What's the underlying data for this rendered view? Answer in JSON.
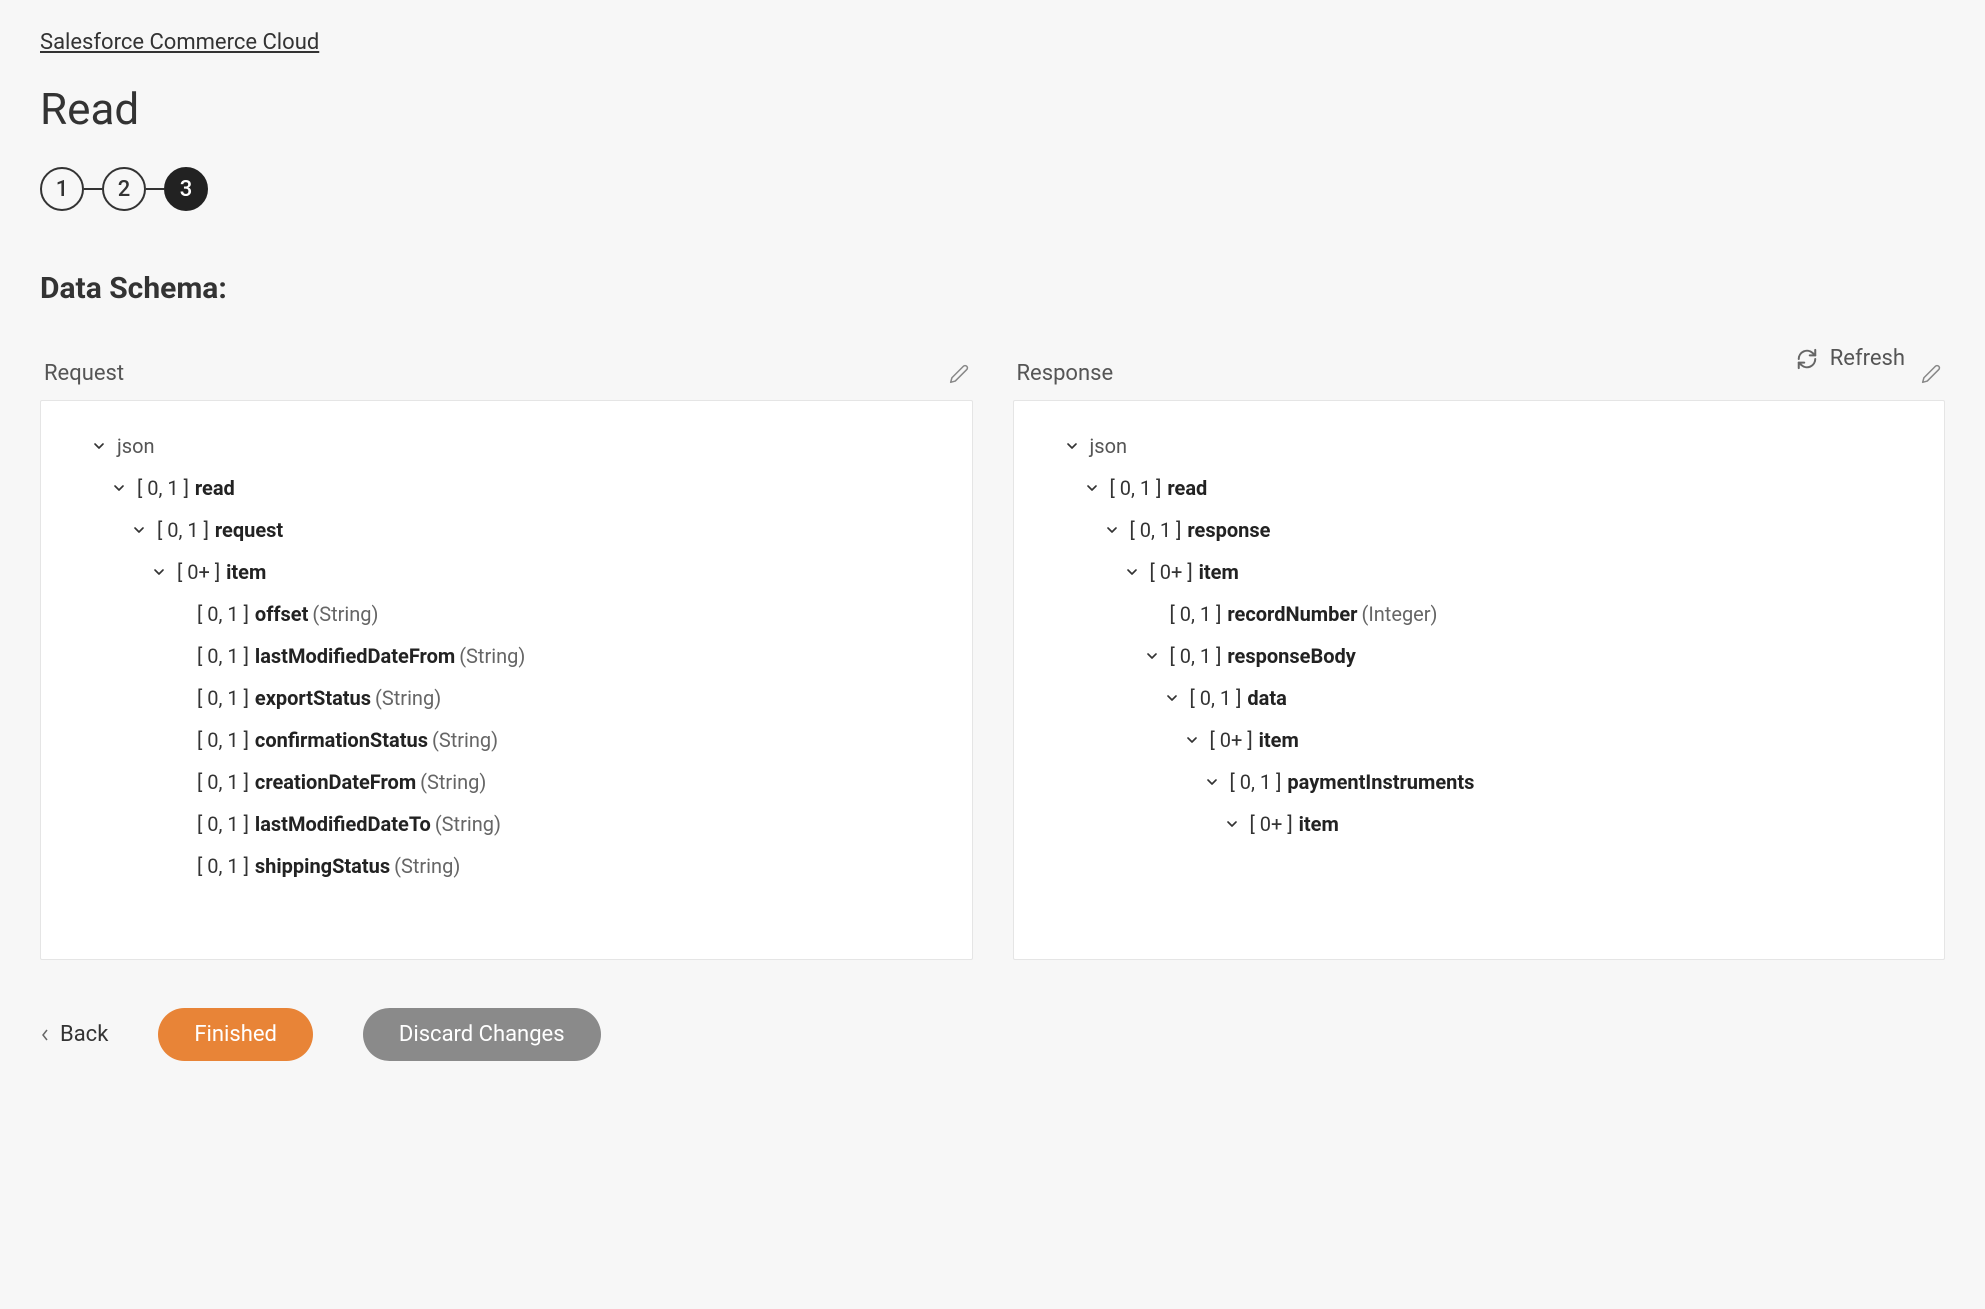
{
  "breadcrumb": {
    "link_label": "Salesforce Commerce Cloud"
  },
  "page": {
    "title": "Read"
  },
  "stepper": {
    "steps": [
      "1",
      "2",
      "3"
    ],
    "active_index": 2
  },
  "section": {
    "heading": "Data Schema:"
  },
  "actions": {
    "refresh_label": "Refresh",
    "back_label": "Back",
    "finished_label": "Finished",
    "discard_label": "Discard Changes"
  },
  "panels": {
    "request": {
      "label": "Request",
      "tree": [
        {
          "indent": 0,
          "expandable": true,
          "cardinality": "",
          "name": "json",
          "bold": false,
          "type": ""
        },
        {
          "indent": 1,
          "expandable": true,
          "cardinality": "[ 0, 1 ]",
          "name": "read",
          "bold": true,
          "type": ""
        },
        {
          "indent": 2,
          "expandable": true,
          "cardinality": "[ 0, 1 ]",
          "name": "request",
          "bold": true,
          "type": ""
        },
        {
          "indent": 3,
          "expandable": true,
          "cardinality": "[ 0+ ]",
          "name": "item",
          "bold": true,
          "type": ""
        },
        {
          "indent": 4,
          "expandable": false,
          "cardinality": "[ 0, 1 ]",
          "name": "offset",
          "bold": true,
          "type": "(String)"
        },
        {
          "indent": 4,
          "expandable": false,
          "cardinality": "[ 0, 1 ]",
          "name": "lastModifiedDateFrom",
          "bold": true,
          "type": "(String)"
        },
        {
          "indent": 4,
          "expandable": false,
          "cardinality": "[ 0, 1 ]",
          "name": "exportStatus",
          "bold": true,
          "type": "(String)"
        },
        {
          "indent": 4,
          "expandable": false,
          "cardinality": "[ 0, 1 ]",
          "name": "confirmationStatus",
          "bold": true,
          "type": "(String)"
        },
        {
          "indent": 4,
          "expandable": false,
          "cardinality": "[ 0, 1 ]",
          "name": "creationDateFrom",
          "bold": true,
          "type": "(String)"
        },
        {
          "indent": 4,
          "expandable": false,
          "cardinality": "[ 0, 1 ]",
          "name": "lastModifiedDateTo",
          "bold": true,
          "type": "(String)"
        },
        {
          "indent": 4,
          "expandable": false,
          "cardinality": "[ 0, 1 ]",
          "name": "shippingStatus",
          "bold": true,
          "type": "(String)"
        }
      ]
    },
    "response": {
      "label": "Response",
      "tree": [
        {
          "indent": 0,
          "expandable": true,
          "cardinality": "",
          "name": "json",
          "bold": false,
          "type": ""
        },
        {
          "indent": 1,
          "expandable": true,
          "cardinality": "[ 0, 1 ]",
          "name": "read",
          "bold": true,
          "type": ""
        },
        {
          "indent": 2,
          "expandable": true,
          "cardinality": "[ 0, 1 ]",
          "name": "response",
          "bold": true,
          "type": ""
        },
        {
          "indent": 3,
          "expandable": true,
          "cardinality": "[ 0+ ]",
          "name": "item",
          "bold": true,
          "type": ""
        },
        {
          "indent": 4,
          "expandable": false,
          "cardinality": "[ 0, 1 ]",
          "name": "recordNumber",
          "bold": true,
          "type": "(Integer)"
        },
        {
          "indent": 4,
          "expandable": true,
          "cardinality": "[ 0, 1 ]",
          "name": "responseBody",
          "bold": true,
          "type": ""
        },
        {
          "indent": 5,
          "expandable": true,
          "cardinality": "[ 0, 1 ]",
          "name": "data",
          "bold": true,
          "type": ""
        },
        {
          "indent": 6,
          "expandable": true,
          "cardinality": "[ 0+ ]",
          "name": "item",
          "bold": true,
          "type": ""
        },
        {
          "indent": 7,
          "expandable": true,
          "cardinality": "[ 0, 1 ]",
          "name": "paymentInstruments",
          "bold": true,
          "type": ""
        },
        {
          "indent": 8,
          "expandable": true,
          "cardinality": "[ 0+ ]",
          "name": "item",
          "bold": true,
          "type": ""
        }
      ]
    }
  }
}
